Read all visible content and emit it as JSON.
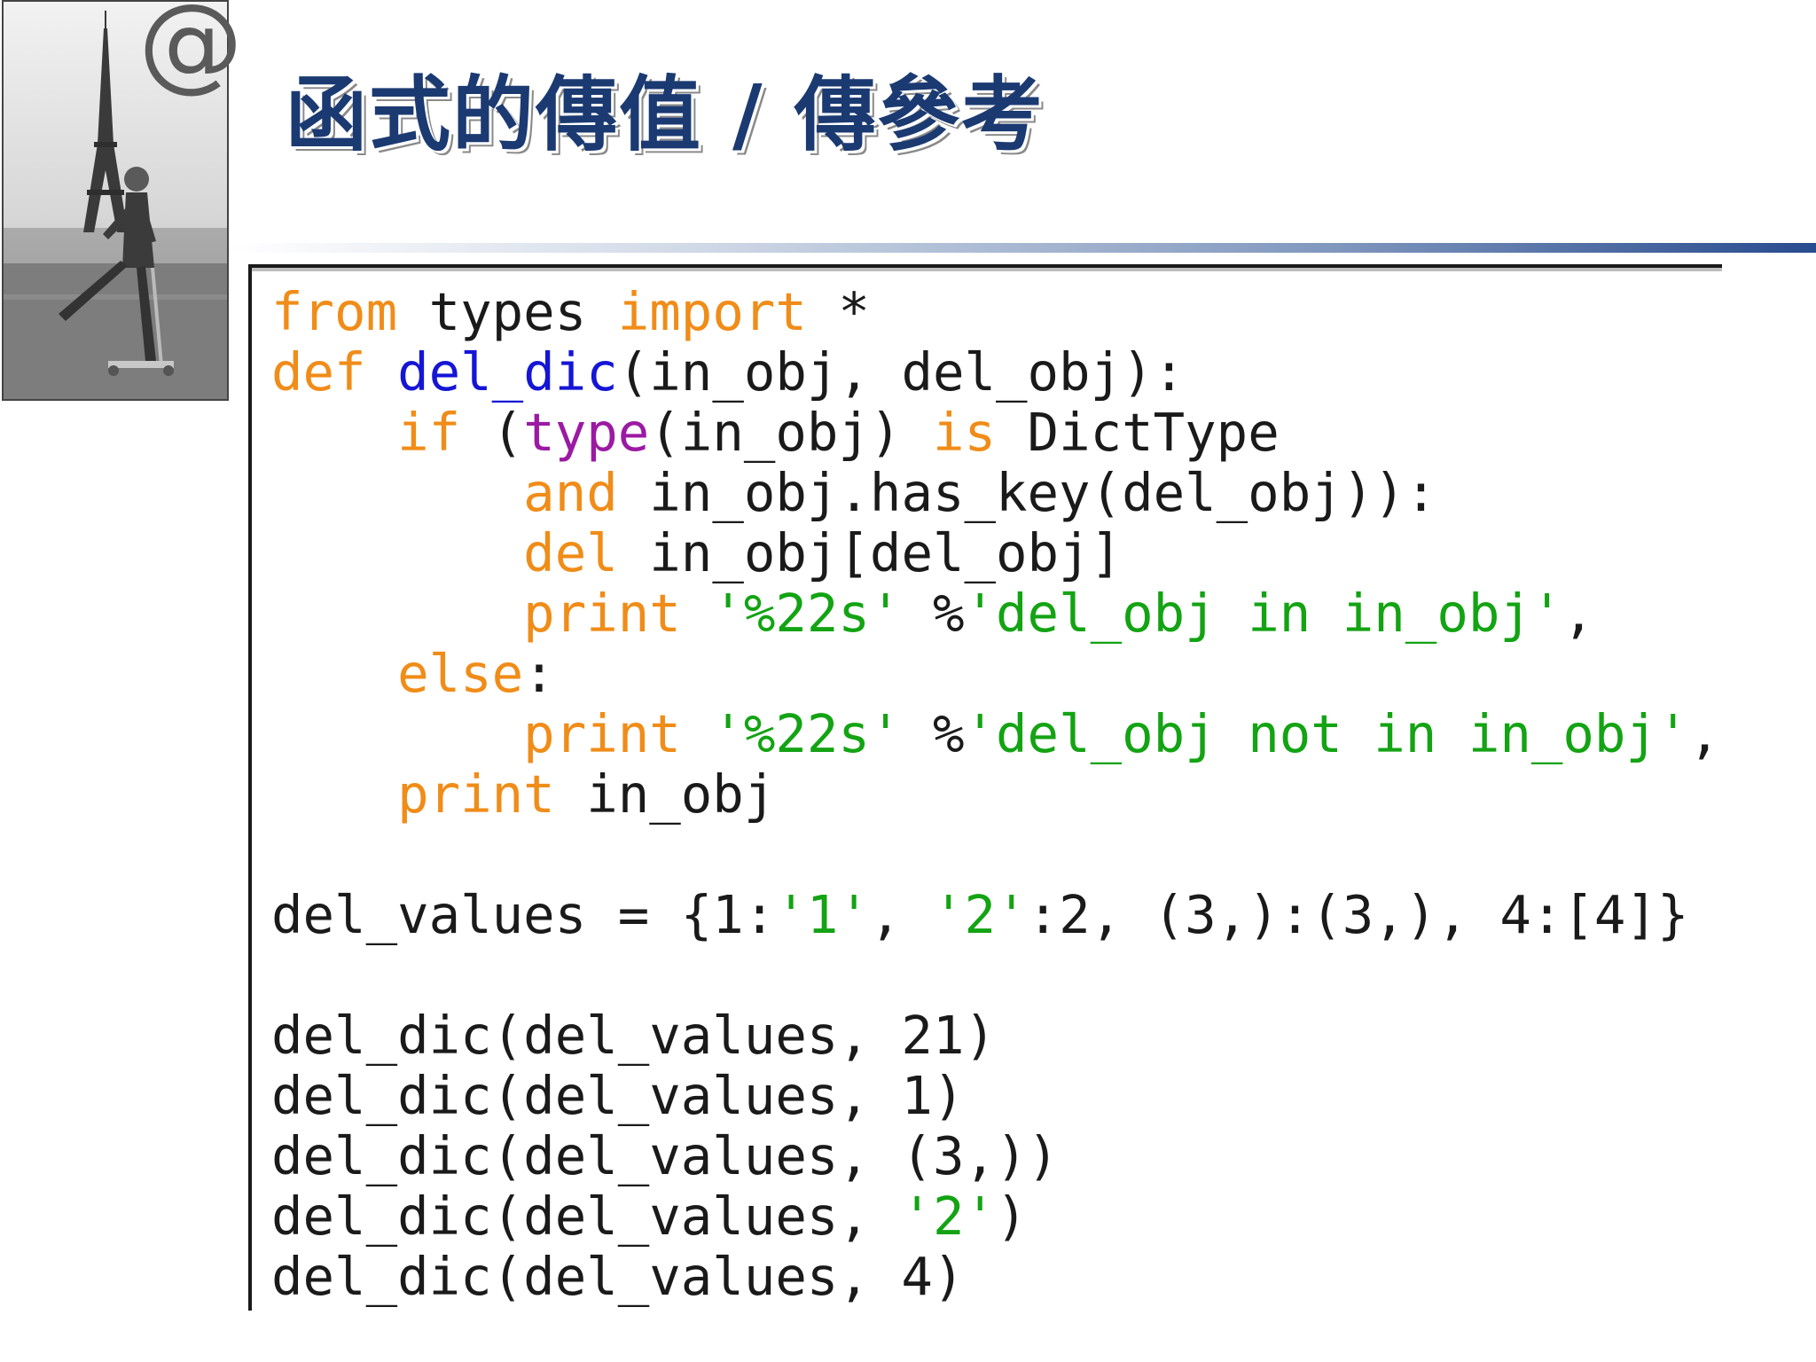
{
  "slide": {
    "title": "函式的傳值 / 傳參考",
    "logo_text": "@",
    "photo_icon": "eiffel-tower-scooter-man-photo"
  },
  "colors": {
    "title": "#1b3a72",
    "keyword": "#f08c18",
    "function_name": "#1515d6",
    "builtin": "#9b1aa3",
    "string": "#13a313",
    "text": "#1a1a1a"
  },
  "code": {
    "lines": [
      [
        {
          "t": "from",
          "c": "kw"
        },
        {
          "t": " types ",
          "c": "tx"
        },
        {
          "t": "import",
          "c": "kw"
        },
        {
          "t": " *",
          "c": "tx"
        }
      ],
      [
        {
          "t": "def",
          "c": "kw"
        },
        {
          "t": " ",
          "c": "tx"
        },
        {
          "t": "del_dic",
          "c": "fn"
        },
        {
          "t": "(in_obj, del_obj):",
          "c": "tx"
        }
      ],
      [
        {
          "t": "    ",
          "c": "tx"
        },
        {
          "t": "if",
          "c": "kw"
        },
        {
          "t": " (",
          "c": "tx"
        },
        {
          "t": "type",
          "c": "bi"
        },
        {
          "t": "(in_obj) ",
          "c": "tx"
        },
        {
          "t": "is",
          "c": "kw"
        },
        {
          "t": " DictType",
          "c": "tx"
        }
      ],
      [
        {
          "t": "        ",
          "c": "tx"
        },
        {
          "t": "and",
          "c": "kw"
        },
        {
          "t": " in_obj.has_key(del_obj)):",
          "c": "tx"
        }
      ],
      [
        {
          "t": "        ",
          "c": "tx"
        },
        {
          "t": "del",
          "c": "kw"
        },
        {
          "t": " in_obj[del_obj]",
          "c": "tx"
        }
      ],
      [
        {
          "t": "        ",
          "c": "tx"
        },
        {
          "t": "print",
          "c": "kw"
        },
        {
          "t": " ",
          "c": "tx"
        },
        {
          "t": "'%22s'",
          "c": "st"
        },
        {
          "t": " %",
          "c": "tx"
        },
        {
          "t": "'del_obj in in_obj'",
          "c": "st"
        },
        {
          "t": ",",
          "c": "tx"
        }
      ],
      [
        {
          "t": "    ",
          "c": "tx"
        },
        {
          "t": "else",
          "c": "kw"
        },
        {
          "t": ":",
          "c": "tx"
        }
      ],
      [
        {
          "t": "        ",
          "c": "tx"
        },
        {
          "t": "print",
          "c": "kw"
        },
        {
          "t": " ",
          "c": "tx"
        },
        {
          "t": "'%22s'",
          "c": "st"
        },
        {
          "t": " %",
          "c": "tx"
        },
        {
          "t": "'del_obj not in in_obj'",
          "c": "st"
        },
        {
          "t": ",",
          "c": "tx"
        }
      ],
      [
        {
          "t": "    ",
          "c": "tx"
        },
        {
          "t": "print",
          "c": "kw"
        },
        {
          "t": " in_obj",
          "c": "tx"
        }
      ],
      [
        {
          "t": "",
          "c": "tx"
        }
      ],
      [
        {
          "t": "del_values = {1:",
          "c": "tx"
        },
        {
          "t": "'1'",
          "c": "st"
        },
        {
          "t": ", ",
          "c": "tx"
        },
        {
          "t": "'2'",
          "c": "st"
        },
        {
          "t": ":2, (3,):(3,), 4:[4]}",
          "c": "tx"
        }
      ],
      [
        {
          "t": "",
          "c": "tx"
        }
      ],
      [
        {
          "t": "del_dic(del_values, 21)",
          "c": "tx"
        }
      ],
      [
        {
          "t": "del_dic(del_values, 1)",
          "c": "tx"
        }
      ],
      [
        {
          "t": "del_dic(del_values, (3,))",
          "c": "tx"
        }
      ],
      [
        {
          "t": "del_dic(del_values, ",
          "c": "tx"
        },
        {
          "t": "'2'",
          "c": "st"
        },
        {
          "t": ")",
          "c": "tx"
        }
      ],
      [
        {
          "t": "del_dic(del_values, 4)",
          "c": "tx"
        }
      ]
    ]
  }
}
